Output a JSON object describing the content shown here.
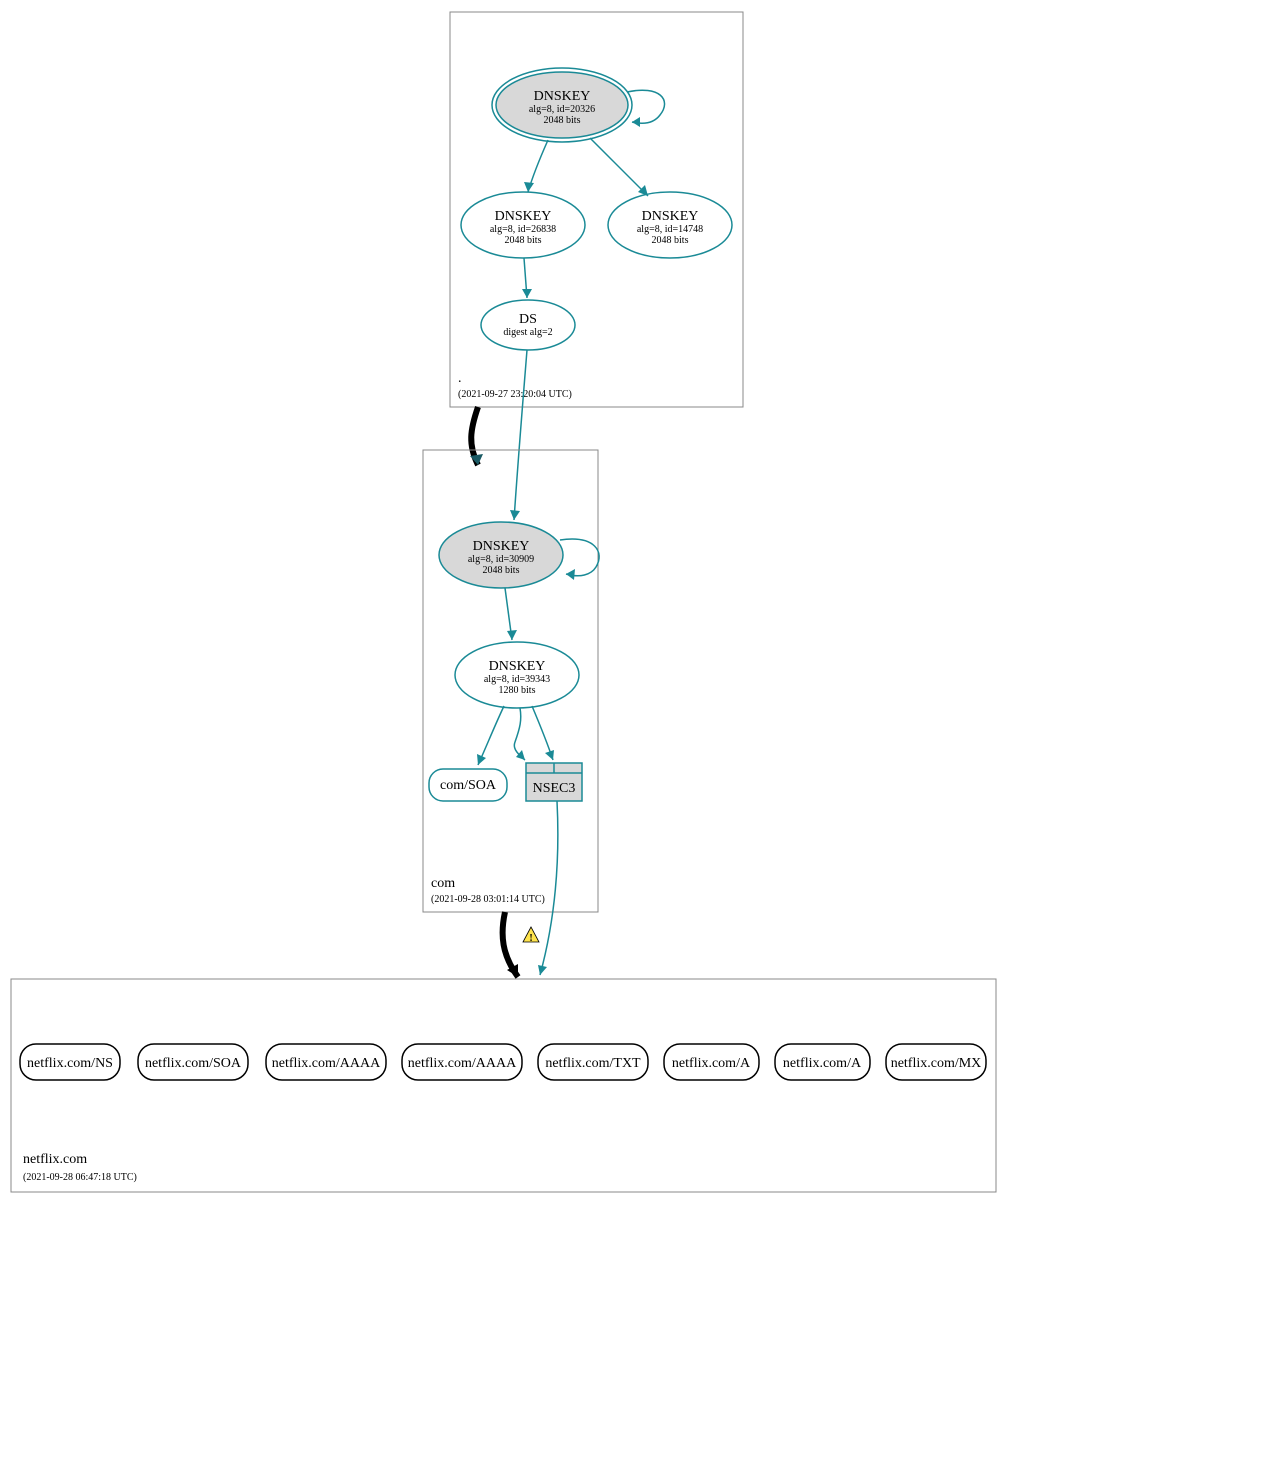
{
  "root_zone": {
    "label": ".",
    "timestamp": "(2021-09-27 23:20:04 UTC)",
    "ksk": {
      "title": "DNSKEY",
      "line1": "alg=8, id=20326",
      "line2": "2048 bits"
    },
    "zsk1": {
      "title": "DNSKEY",
      "line1": "alg=8, id=26838",
      "line2": "2048 bits"
    },
    "zsk2": {
      "title": "DNSKEY",
      "line1": "alg=8, id=14748",
      "line2": "2048 bits"
    },
    "ds": {
      "title": "DS",
      "line1": "digest alg=2"
    }
  },
  "com_zone": {
    "label": "com",
    "timestamp": "(2021-09-28 03:01:14 UTC)",
    "ksk": {
      "title": "DNSKEY",
      "line1": "alg=8, id=30909",
      "line2": "2048 bits"
    },
    "zsk": {
      "title": "DNSKEY",
      "line1": "alg=8, id=39343",
      "line2": "1280 bits"
    },
    "soa": {
      "label": "com/SOA"
    },
    "nsec3": {
      "label": "NSEC3"
    }
  },
  "netflix_zone": {
    "label": "netflix.com",
    "timestamp": "(2021-09-28 06:47:18 UTC)",
    "records": [
      "netflix.com/NS",
      "netflix.com/SOA",
      "netflix.com/AAAA",
      "netflix.com/AAAA",
      "netflix.com/TXT",
      "netflix.com/A",
      "netflix.com/A",
      "netflix.com/MX"
    ]
  },
  "warn_glyph": "!"
}
